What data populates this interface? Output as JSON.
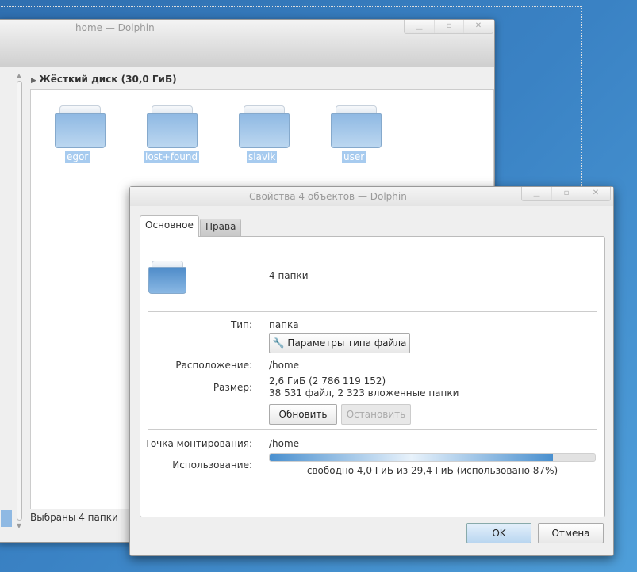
{
  "main_window": {
    "title": "home — Dolphin",
    "place_header": "Жёсткий диск (30,0 ГиБ)",
    "folders": [
      {
        "name": "egor"
      },
      {
        "name": "lost+found"
      },
      {
        "name": "slavik"
      },
      {
        "name": "user"
      }
    ],
    "status": "Выбраны 4 папки"
  },
  "dialog": {
    "title": "Свойства 4 объектов — Dolphin",
    "tabs": [
      {
        "label": "Основное"
      },
      {
        "label": "Права"
      }
    ],
    "summary": "4 папки",
    "type_label": "Тип:",
    "type_value": "папка",
    "file_type_button": "Параметры типа файла",
    "location_label": "Расположение:",
    "location_value": "/home",
    "size_label": "Размер:",
    "size_value": "2,6 ГиБ (2 786 119 152)",
    "size_details": "38 531 файл, 2 323 вложенные папки",
    "refresh_button": "Обновить",
    "stop_button": "Остановить",
    "mount_label": "Точка монтирования:",
    "mount_value": "/home",
    "usage_label": "Использование:",
    "usage_percent": 87,
    "usage_text": "свободно 4,0 ГиБ из 29,4 ГиБ (использовано 87%)",
    "ok_button": "OK",
    "cancel_button": "Отмена"
  }
}
